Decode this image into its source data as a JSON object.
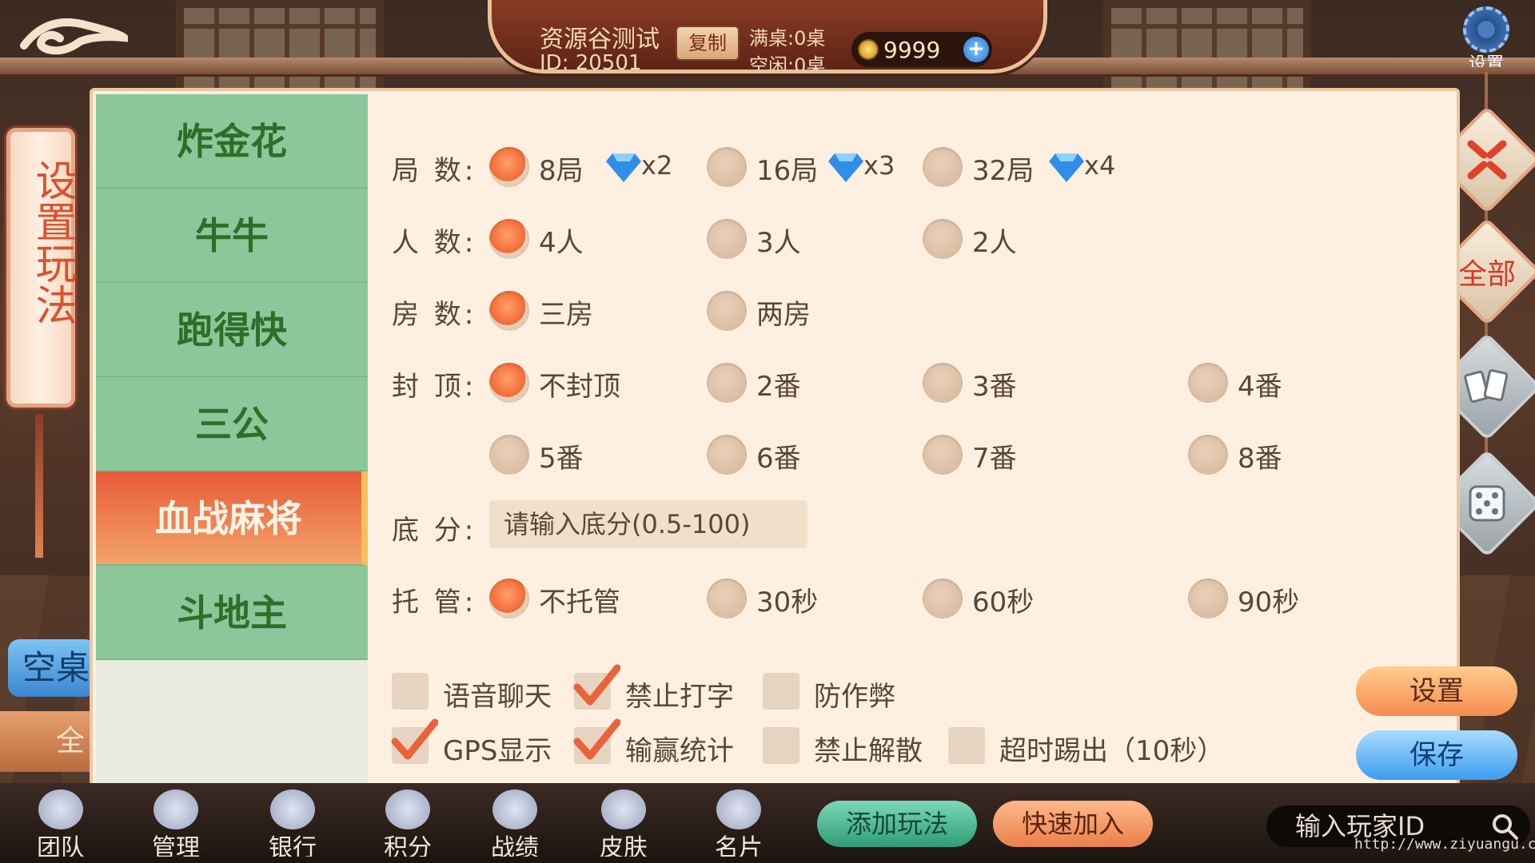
{
  "header": {
    "room_name": "资源谷测试",
    "room_id": "ID: 20501",
    "copy_label": "复制",
    "full_tables": "满桌:0桌",
    "free_tables": "空闲:0桌",
    "coins": "9999",
    "settings_label": "设置"
  },
  "left": {
    "banner_text": "设置玩法",
    "empty_table": "空桌",
    "all_tab": "全部"
  },
  "sidebar": {
    "items": [
      {
        "label": "炸金花"
      },
      {
        "label": "牛牛"
      },
      {
        "label": "跑得快"
      },
      {
        "label": "三公"
      },
      {
        "label": "血战麻将",
        "active": true
      },
      {
        "label": "斗地主"
      }
    ]
  },
  "rules": {
    "rounds": {
      "label": "局 数:",
      "options": [
        {
          "label": "8局",
          "mult": "x2",
          "selected": true
        },
        {
          "label": "16局",
          "mult": "x3",
          "selected": false
        },
        {
          "label": "32局",
          "mult": "x4",
          "selected": false
        }
      ]
    },
    "players": {
      "label": "人 数:",
      "options": [
        {
          "label": "4人",
          "selected": true
        },
        {
          "label": "3人",
          "selected": false
        },
        {
          "label": "2人",
          "selected": false
        }
      ]
    },
    "rooms": {
      "label": "房 数:",
      "options": [
        {
          "label": "三房",
          "selected": true
        },
        {
          "label": "两房",
          "selected": false
        }
      ]
    },
    "cap": {
      "label": "封 顶:",
      "options": [
        {
          "label": "不封顶",
          "selected": true
        },
        {
          "label": "2番",
          "selected": false
        },
        {
          "label": "3番",
          "selected": false
        },
        {
          "label": "4番",
          "selected": false
        },
        {
          "label": "5番",
          "selected": false
        },
        {
          "label": "6番",
          "selected": false
        },
        {
          "label": "7番",
          "selected": false
        },
        {
          "label": "8番",
          "selected": false
        }
      ]
    },
    "base_score": {
      "label": "底 分:",
      "placeholder": "请输入底分(0.5-100)"
    },
    "hosting": {
      "label": "托 管:",
      "options": [
        {
          "label": "不托管",
          "selected": true
        },
        {
          "label": "30秒",
          "selected": false
        },
        {
          "label": "60秒",
          "selected": false
        },
        {
          "label": "90秒",
          "selected": false
        }
      ]
    },
    "checkboxes": [
      {
        "label": "语音聊天",
        "checked": false
      },
      {
        "label": "禁止打字",
        "checked": true
      },
      {
        "label": "防作弊",
        "checked": false
      },
      {
        "label": "GPS显示",
        "checked": true
      },
      {
        "label": "输赢统计",
        "checked": true
      },
      {
        "label": "禁止解散",
        "checked": false
      },
      {
        "label": "超时踢出（10秒）",
        "checked": false
      }
    ],
    "set_button": "设置",
    "save_button": "保存"
  },
  "right_tools": {
    "all_label": "全部"
  },
  "bottom_nav": {
    "items": [
      {
        "label": "团队",
        "icon": "team-icon"
      },
      {
        "label": "管理",
        "icon": "manage-icon"
      },
      {
        "label": "银行",
        "icon": "bank-icon"
      },
      {
        "label": "积分",
        "icon": "points-icon"
      },
      {
        "label": "战绩",
        "icon": "record-icon"
      },
      {
        "label": "皮肤",
        "icon": "skin-icon"
      },
      {
        "label": "名片",
        "icon": "card-icon"
      }
    ],
    "add_rule": "添加玩法",
    "quick_join": "快速加入",
    "search_placeholder": "输入玩家ID",
    "watermark": "http://www.ziyuangu.com/"
  },
  "colors": {
    "selected_radio": "#f26a36",
    "sidebar_green": "#8cc79b",
    "active_tab": "#e85a37",
    "panel_bg": "#fdf0e1"
  }
}
